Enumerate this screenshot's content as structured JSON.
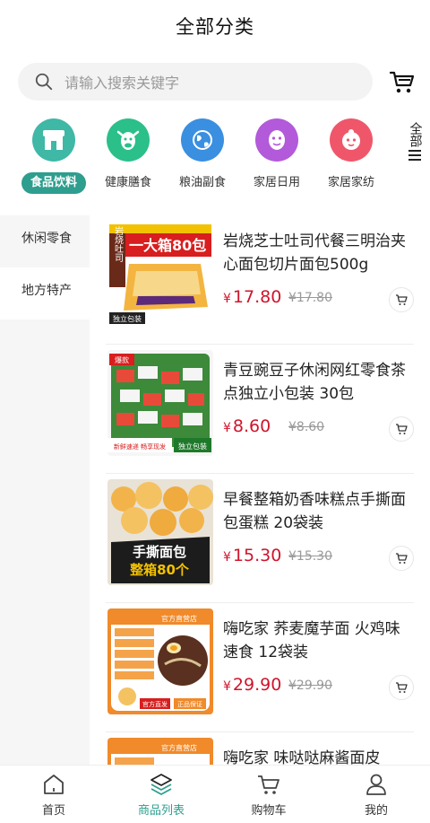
{
  "header": {
    "title": "全部分类"
  },
  "search": {
    "placeholder": "请输入搜索关键字"
  },
  "categories": [
    {
      "label": "食品饮料",
      "color": "#3fb8a6",
      "icon": "shop-icon"
    },
    {
      "label": "健康膳食",
      "color": "#2bbf8a",
      "icon": "cow-icon"
    },
    {
      "label": "粮油副食",
      "color": "#3a8fe0",
      "icon": "globe-icon"
    },
    {
      "label": "家居日用",
      "color": "#b25ad9",
      "icon": "face-mask-icon"
    },
    {
      "label": "家居家纺",
      "color": "#f0566a",
      "icon": "baby-face-icon"
    }
  ],
  "more": {
    "label": "全部"
  },
  "sidebar": {
    "items": [
      {
        "label": "休闲零食"
      },
      {
        "label": "地方特产"
      }
    ]
  },
  "products": [
    {
      "name": "岩烧芝士吐司代餐三明治夹心面包切片面包500g",
      "price": "17.80",
      "orig": "¥17.80",
      "img": {
        "top": "一大箱80包",
        "side": "岩烧吐司",
        "tag": "独立包装"
      }
    },
    {
      "name": "青豆豌豆子休闲网红零食茶点独立小包装 30包",
      "price": "8.60",
      "orig": "¥8.60",
      "img": {
        "top": "爆款",
        "tag": "独立包装",
        "tag2": "新鲜速递 畅享现发"
      }
    },
    {
      "name": "早餐整箱奶香味糕点手撕面包蛋糕 20袋装",
      "price": "15.30",
      "orig": "¥15.30",
      "img": {
        "line1": "手撕面包",
        "line2": "整箱80个"
      }
    },
    {
      "name": "嗨吃家 荞麦魔芋面 火鸡味速食 12袋装",
      "price": "29.90",
      "orig": "¥29.90",
      "img": {
        "top": "官方直营店",
        "tag": "官方直发",
        "tag2": "正品保证"
      }
    },
    {
      "name": "嗨吃家 味哒哒麻酱面皮",
      "price": "",
      "orig": "",
      "img": {
        "top": "官方直营店"
      }
    }
  ],
  "tabs": [
    {
      "label": "首页"
    },
    {
      "label": "商品列表"
    },
    {
      "label": "购物车"
    },
    {
      "label": "我的"
    }
  ],
  "colors": {
    "accent": "#2e9e8e",
    "price": "#d0142c"
  },
  "currency": "¥"
}
